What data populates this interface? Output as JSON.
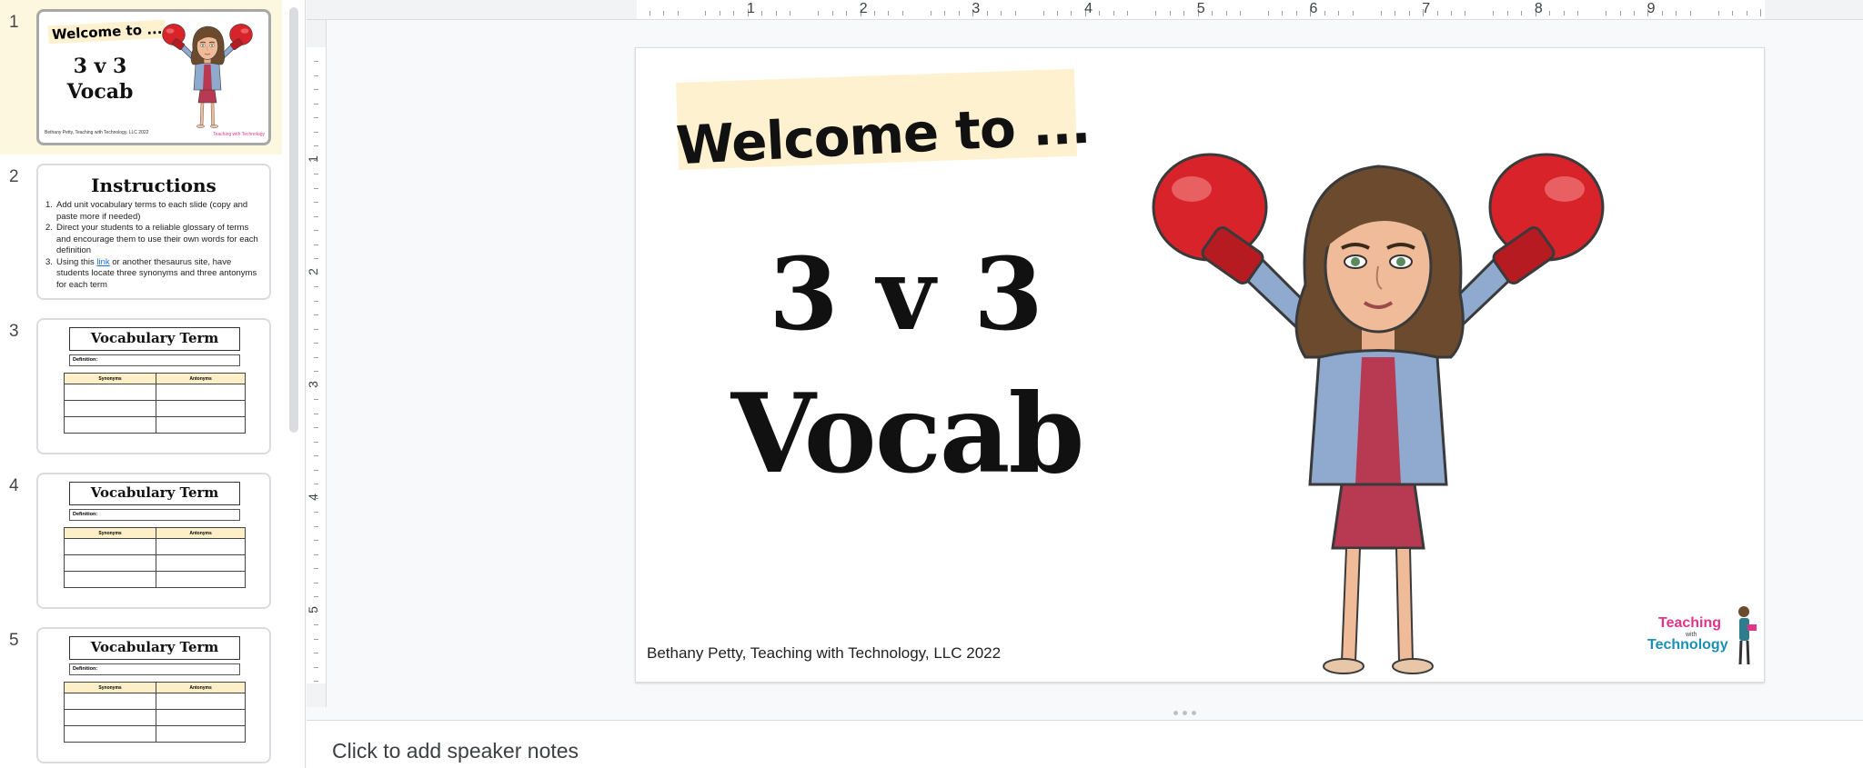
{
  "filmstrip": {
    "slides": [
      {
        "number": "1",
        "welcome": "Welcome to ...",
        "title_line1": "3 v 3",
        "title_line2": "Vocab",
        "credit": "Bethany Petty, Teaching with Technology, LLC 2022",
        "logo": "Teaching with Technology"
      },
      {
        "number": "2",
        "title": "Instructions",
        "items": [
          "Add unit vocabulary terms to each slide (copy and paste more if needed)",
          "Direct your students to a reliable glossary of terms and encourage them to use their own words for each definition",
          "Using this",
          "link",
          "or another thesaurus site, have students locate three synonyms and three antonyms for each term"
        ]
      },
      {
        "number": "3",
        "title": "Vocabulary Term",
        "definition_label": "Definition:",
        "col1": "Synonyms",
        "col2": "Antonyms"
      },
      {
        "number": "4",
        "title": "Vocabulary Term",
        "definition_label": "Definition:",
        "col1": "Synonyms",
        "col2": "Antonyms"
      },
      {
        "number": "5",
        "title": "Vocabulary Term",
        "definition_label": "Definition:",
        "col1": "Synonyms",
        "col2": "Antonyms"
      }
    ]
  },
  "ruler": {
    "top_labels": [
      "1",
      "2",
      "3",
      "4",
      "5",
      "6",
      "7",
      "8",
      "9"
    ],
    "left_labels": [
      "1",
      "2",
      "3",
      "4",
      "5"
    ]
  },
  "slide": {
    "welcome": "Welcome to ...",
    "title_line1": "3 v 3",
    "title_line2": "Vocab",
    "credit": "Bethany Petty, Teaching with Technology, LLC 2022",
    "logo_teaching": "Teaching",
    "logo_with": "with",
    "logo_technology": "Technology"
  },
  "notes": {
    "placeholder": "Click to add speaker notes"
  },
  "colors": {
    "selected_row": "#fef7e0",
    "welcome_highlight": "#fdf1cf",
    "table_header": "#fdf0c8",
    "boxing_glove": "#d9232a",
    "logo_pink": "#e2358a",
    "logo_blue": "#1a8fb3"
  }
}
